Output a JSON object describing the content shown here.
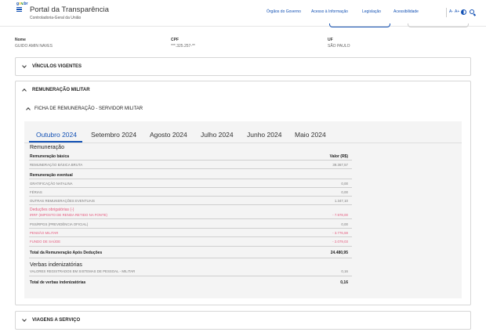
{
  "header": {
    "title": "Portal da Transparência",
    "subtitle": "Controladoria-Geral da União",
    "nav": [
      "Órgãos do Governo",
      "Acesso à Informação",
      "Legislação",
      "Acessibilidade"
    ],
    "font_decrease": "A-",
    "font_increase": "A+",
    "brand_colors": {
      "primary": "#1351b4",
      "negative": "#e4587c"
    }
  },
  "person": {
    "nome_label": "Nome",
    "nome_value": "GUIDO AMIN NAVES",
    "cpf_label": "CPF",
    "cpf_value": "***.325.257-**",
    "uf_label": "UF",
    "uf_value": "SÃO PAULO"
  },
  "sections": {
    "vinculos": "VÍNCULOS VIGENTES",
    "remuneracao_militar": "REMUNERAÇÃO MILITAR",
    "ficha": "FICHA DE REMUNERAÇÃO - SERVIDOR MILITAR",
    "viagens": "VIAGENS A SERVIÇO"
  },
  "tabs": [
    "Outubro 2024",
    "Setembro 2024",
    "Agosto 2024",
    "Julho 2024",
    "Junho 2024",
    "Maio 2024"
  ],
  "table": {
    "remuneracao_title": "Remuneração",
    "basica_label": "Remuneração básica",
    "valor_header": "Valor (R$)",
    "basica_bruta_label": "REMUNERAÇÃO BÁSICA BRUTA",
    "basica_bruta_value": "39.367,57",
    "eventual_label": "Remuneração eventual",
    "gratificacao_label": "GRATIFICAÇÃO NATALINA",
    "gratificacao_value": "0,00",
    "ferias_label": "FÉRIAS",
    "ferias_value": "0,00",
    "outras_label": "OUTRAS REMUNERAÇÕES EVENTUAIS",
    "outras_value": "1.347,10",
    "deducoes_label": "Deduções obrigatórias (-)",
    "irrf_label": "IRRF (IMPOSTO DE RENDA RETIDO NA FONTE)",
    "irrf_value": "- 7.978,00",
    "pss_label": "PSS/RPGS (PREVIDÊNCIA OFICIAL)",
    "pss_value": "0,00",
    "pensao_label": "PENSÃO MILITAR",
    "pensao_value": "- 3.776,59",
    "fundo_label": "FUNDO DE SAÚDE",
    "fundo_value": "- 2.079,03",
    "total_label": "Total da Remuneração Após Deduções",
    "total_value": "24.480,95",
    "verbas_title": "Verbas indenizatórias",
    "verbas_label": "VALORES REGISTRADOS EM SISTEMAS DE PESSOAL - MILITAR",
    "verbas_value": "0,16",
    "total_verbas_label": "Total de verbas indenizatórias",
    "total_verbas_value": "0,16"
  }
}
